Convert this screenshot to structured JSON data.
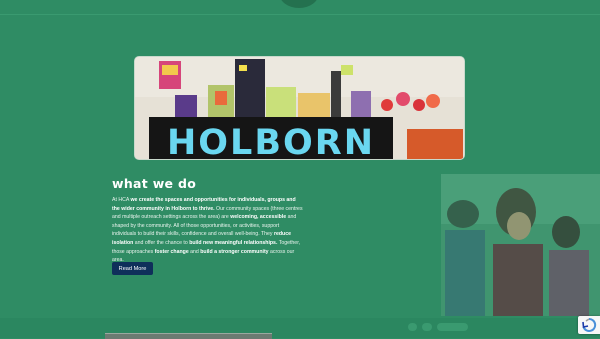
{
  "colors": {
    "background": "#2f8c64",
    "button": "#0f2f5a",
    "text": "#ffffff"
  },
  "hero": {
    "sign_text": "HOLBORN"
  },
  "section": {
    "heading": "what we do",
    "body": [
      {
        "t": "At HCA ",
        "b": false
      },
      {
        "t": "we create the spaces and opportunities for individuals, groups and the wider community in Holborn to thrive.",
        "b": true
      },
      {
        "t": "  Our community spaces (three centres and multiple outreach settings across the area) are ",
        "b": false
      },
      {
        "t": "welcoming, accessible",
        "b": true
      },
      {
        "t": " and shaped by the community.  All of those opportunities, or activities, support individuals to build their skills, confidence and overall well-being. They ",
        "b": false
      },
      {
        "t": "reduce isolation",
        "b": true
      },
      {
        "t": " and offer the chance to ",
        "b": false
      },
      {
        "t": "build new meaningful relationships.",
        "b": true
      },
      {
        "t": " Together, those approaches ",
        "b": false
      },
      {
        "t": "foster change",
        "b": true
      },
      {
        "t": " and ",
        "b": false
      },
      {
        "t": "build a stronger community",
        "b": true
      },
      {
        "t": " across our area.",
        "b": false
      }
    ],
    "read_more_label": "Read More"
  },
  "icons": {
    "recaptcha": "recaptcha-icon"
  }
}
